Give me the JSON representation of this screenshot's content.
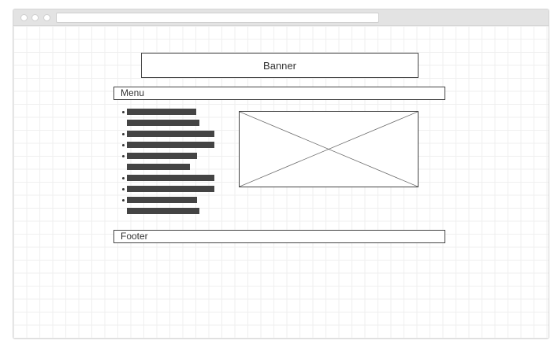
{
  "wireframe": {
    "banner_label": "Banner",
    "menu_label": "Menu",
    "footer_label": "Footer",
    "list_items": [
      {
        "lines": [
          0.62,
          0.65
        ]
      },
      {
        "lines": [
          0.78
        ]
      },
      {
        "lines": [
          0.78
        ]
      },
      {
        "lines": [
          0.63,
          0.56
        ]
      },
      {
        "lines": [
          0.78
        ]
      },
      {
        "lines": [
          0.78
        ]
      },
      {
        "lines": [
          0.63,
          0.65
        ]
      }
    ],
    "image_icon": "image-placeholder-icon"
  }
}
